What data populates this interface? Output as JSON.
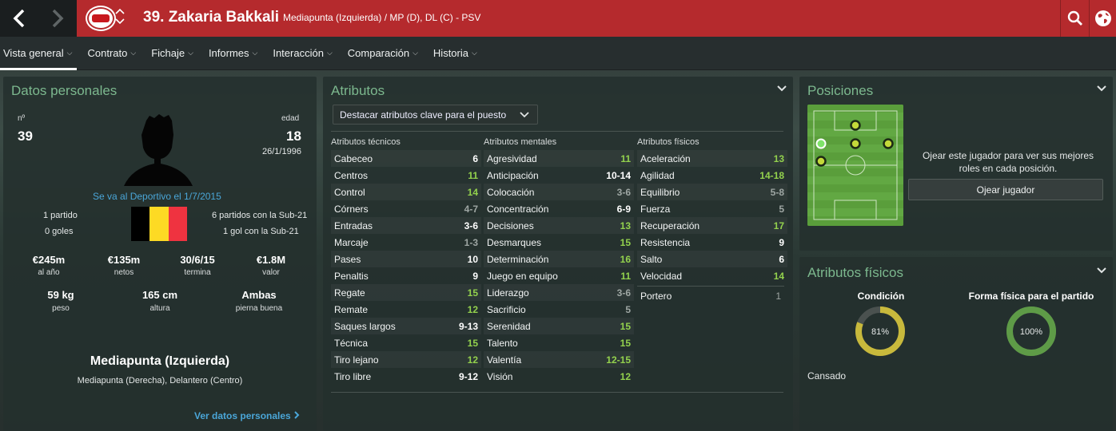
{
  "header": {
    "back_icon": "chevron-left-icon",
    "forward_icon": "chevron-right-icon",
    "club_logo": "psv-crest",
    "player_name": "39. Zakaria Bakkali",
    "position_line": "Mediapunta (Izquierda) / MP (D), DL (C) - PSV",
    "search_icon": "search-icon",
    "globe_icon": "globe-icon",
    "bar_color": "#b52a2d"
  },
  "menu": [
    {
      "label": "Vista general",
      "active": true
    },
    {
      "label": "Contrato"
    },
    {
      "label": "Fichaje"
    },
    {
      "label": "Informes"
    },
    {
      "label": "Interacción"
    },
    {
      "label": "Comparación"
    },
    {
      "label": "Historia"
    }
  ],
  "personal": {
    "title": "Datos personales",
    "number_label": "nº",
    "number": "39",
    "age_label": "edad",
    "age": "18",
    "dob": "26/1/1996",
    "transfer_note": "Se va al Deportivo el 1/7/2015",
    "matches": "1 partido",
    "goals": "0 goles",
    "u21_matches": "6 partidos con la Sub-21",
    "u21_goals": "1 gol con la Sub-21",
    "flag_colors": [
      "#000000",
      "#fdda24",
      "#ef3340"
    ],
    "stats": [
      {
        "value": "€245m",
        "label": "al año"
      },
      {
        "value": "€135m",
        "label": "netos"
      },
      {
        "value": "30/6/15",
        "label": "termina"
      },
      {
        "value": "€1.8M",
        "label": "valor"
      }
    ],
    "body": [
      {
        "value": "59 kg",
        "label": "peso"
      },
      {
        "value": "165 cm",
        "label": "altura"
      },
      {
        "value": "Ambas",
        "label": "pierna buena"
      }
    ],
    "main_position": "Mediapunta (Izquierda)",
    "other_positions": "Mediapunta (Derecha), Delantero (Centro)",
    "more_link": "Ver datos personales"
  },
  "attributes": {
    "title": "Atributos",
    "highlight_dropdown": "Destacar atributos clave para el puesto",
    "technical_header": "Atributos técnicos",
    "mental_header": "Atributos mentales",
    "physical_header": "Atributos físicos",
    "technical": [
      {
        "name": "Cabeceo",
        "value": "6",
        "tone": "white"
      },
      {
        "name": "Centros",
        "value": "11",
        "tone": "green"
      },
      {
        "name": "Control",
        "value": "14",
        "tone": "green"
      },
      {
        "name": "Córners",
        "value": "4-7",
        "tone": "grey"
      },
      {
        "name": "Entradas",
        "value": "3-6",
        "tone": "white"
      },
      {
        "name": "Marcaje",
        "value": "1-3",
        "tone": "grey"
      },
      {
        "name": "Pases",
        "value": "10",
        "tone": "white"
      },
      {
        "name": "Penaltis",
        "value": "9",
        "tone": "white"
      },
      {
        "name": "Regate",
        "value": "15",
        "tone": "green"
      },
      {
        "name": "Remate",
        "value": "12",
        "tone": "green"
      },
      {
        "name": "Saques largos",
        "value": "9-13",
        "tone": "white"
      },
      {
        "name": "Técnica",
        "value": "15",
        "tone": "green"
      },
      {
        "name": "Tiro lejano",
        "value": "12",
        "tone": "green"
      },
      {
        "name": "Tiro libre",
        "value": "9-12",
        "tone": "white"
      }
    ],
    "mental": [
      {
        "name": "Agresividad",
        "value": "11",
        "tone": "green"
      },
      {
        "name": "Anticipación",
        "value": "10-14",
        "tone": "white"
      },
      {
        "name": "Colocación",
        "value": "3-6",
        "tone": "grey"
      },
      {
        "name": "Concentración",
        "value": "6-9",
        "tone": "white"
      },
      {
        "name": "Decisiones",
        "value": "13",
        "tone": "green"
      },
      {
        "name": "Desmarques",
        "value": "15",
        "tone": "green"
      },
      {
        "name": "Determinación",
        "value": "16",
        "tone": "green"
      },
      {
        "name": "Juego en equipo",
        "value": "11",
        "tone": "green"
      },
      {
        "name": "Liderazgo",
        "value": "3-6",
        "tone": "grey"
      },
      {
        "name": "Sacrificio",
        "value": "5",
        "tone": "grey"
      },
      {
        "name": "Serenidad",
        "value": "15",
        "tone": "green"
      },
      {
        "name": "Talento",
        "value": "15",
        "tone": "green"
      },
      {
        "name": "Valentía",
        "value": "12-15",
        "tone": "green"
      },
      {
        "name": "Visión",
        "value": "12",
        "tone": "green"
      }
    ],
    "physical": [
      {
        "name": "Aceleración",
        "value": "13",
        "tone": "green"
      },
      {
        "name": "Agilidad",
        "value": "14-18",
        "tone": "green"
      },
      {
        "name": "Equilibrio",
        "value": "5-8",
        "tone": "grey"
      },
      {
        "name": "Fuerza",
        "value": "5",
        "tone": "grey"
      },
      {
        "name": "Recuperación",
        "value": "17",
        "tone": "green"
      },
      {
        "name": "Resistencia",
        "value": "9",
        "tone": "white"
      },
      {
        "name": "Salto",
        "value": "6",
        "tone": "white"
      },
      {
        "name": "Velocidad",
        "value": "14",
        "tone": "green"
      }
    ],
    "goalkeeper": {
      "name": "Portero",
      "value": "1",
      "tone": "grey"
    }
  },
  "positions": {
    "title": "Posiciones",
    "scout_text_1": "Ojear este jugador para ver sus mejores",
    "scout_text_2": "roles en cada posición.",
    "scout_button": "Ojear jugador"
  },
  "physical_panel": {
    "title": "Atributos físicos",
    "condition_label": "Condición",
    "condition_value": "81%",
    "condition_fraction": 0.81,
    "fitness_label": "Forma física para el partido",
    "fitness_value": "100%",
    "fitness_fraction": 1.0,
    "status": "Cansado",
    "condition_color": "#c8b93c",
    "fitness_color": "#5e9b47"
  }
}
